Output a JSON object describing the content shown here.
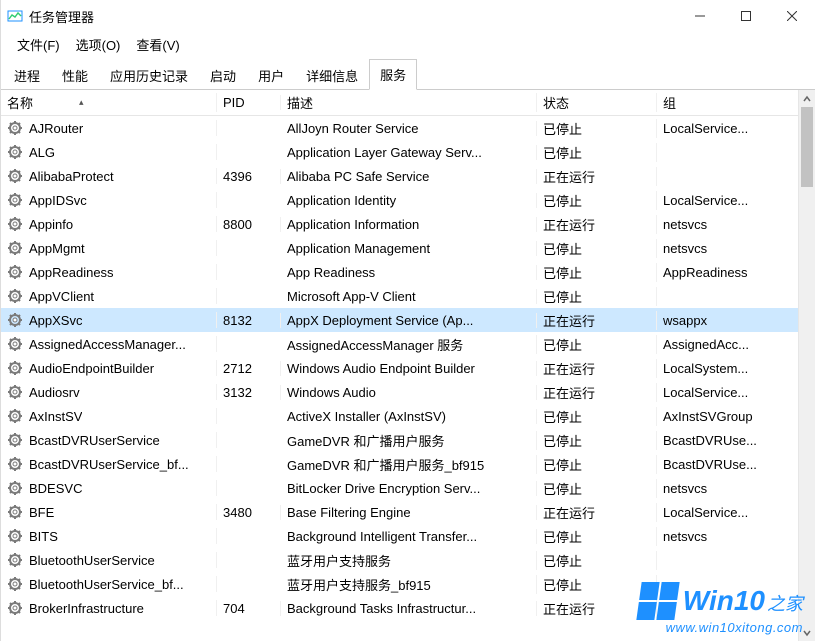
{
  "window": {
    "title": "任务管理器"
  },
  "menu": {
    "file": "文件(F)",
    "options": "选项(O)",
    "view": "查看(V)"
  },
  "tabs": {
    "processes": "进程",
    "performance": "性能",
    "app_history": "应用历史记录",
    "startup": "启动",
    "users": "用户",
    "details": "详细信息",
    "services": "服务"
  },
  "columns": {
    "name": "名称",
    "pid": "PID",
    "desc": "描述",
    "state": "状态",
    "group": "组"
  },
  "states": {
    "stopped": "已停止",
    "running": "正在运行"
  },
  "selected_index": 8,
  "services": [
    {
      "name": "AJRouter",
      "pid": "",
      "desc": "AllJoyn Router Service",
      "state": "已停止",
      "group": "LocalService..."
    },
    {
      "name": "ALG",
      "pid": "",
      "desc": "Application Layer Gateway Serv...",
      "state": "已停止",
      "group": ""
    },
    {
      "name": "AlibabaProtect",
      "pid": "4396",
      "desc": "Alibaba PC Safe Service",
      "state": "正在运行",
      "group": ""
    },
    {
      "name": "AppIDSvc",
      "pid": "",
      "desc": "Application Identity",
      "state": "已停止",
      "group": "LocalService..."
    },
    {
      "name": "Appinfo",
      "pid": "8800",
      "desc": "Application Information",
      "state": "正在运行",
      "group": "netsvcs"
    },
    {
      "name": "AppMgmt",
      "pid": "",
      "desc": "Application Management",
      "state": "已停止",
      "group": "netsvcs"
    },
    {
      "name": "AppReadiness",
      "pid": "",
      "desc": "App Readiness",
      "state": "已停止",
      "group": "AppReadiness"
    },
    {
      "name": "AppVClient",
      "pid": "",
      "desc": "Microsoft App-V Client",
      "state": "已停止",
      "group": ""
    },
    {
      "name": "AppXSvc",
      "pid": "8132",
      "desc": "AppX Deployment Service (Ap...",
      "state": "正在运行",
      "group": "wsappx"
    },
    {
      "name": "AssignedAccessManager...",
      "pid": "",
      "desc": "AssignedAccessManager 服务",
      "state": "已停止",
      "group": "AssignedAcc..."
    },
    {
      "name": "AudioEndpointBuilder",
      "pid": "2712",
      "desc": "Windows Audio Endpoint Builder",
      "state": "正在运行",
      "group": "LocalSystem..."
    },
    {
      "name": "Audiosrv",
      "pid": "3132",
      "desc": "Windows Audio",
      "state": "正在运行",
      "group": "LocalService..."
    },
    {
      "name": "AxInstSV",
      "pid": "",
      "desc": "ActiveX Installer (AxInstSV)",
      "state": "已停止",
      "group": "AxInstSVGroup"
    },
    {
      "name": "BcastDVRUserService",
      "pid": "",
      "desc": "GameDVR 和广播用户服务",
      "state": "已停止",
      "group": "BcastDVRUse..."
    },
    {
      "name": "BcastDVRUserService_bf...",
      "pid": "",
      "desc": "GameDVR 和广播用户服务_bf915",
      "state": "已停止",
      "group": "BcastDVRUse..."
    },
    {
      "name": "BDESVC",
      "pid": "",
      "desc": "BitLocker Drive Encryption Serv...",
      "state": "已停止",
      "group": "netsvcs"
    },
    {
      "name": "BFE",
      "pid": "3480",
      "desc": "Base Filtering Engine",
      "state": "正在运行",
      "group": "LocalService..."
    },
    {
      "name": "BITS",
      "pid": "",
      "desc": "Background Intelligent Transfer...",
      "state": "已停止",
      "group": "netsvcs"
    },
    {
      "name": "BluetoothUserService",
      "pid": "",
      "desc": "蓝牙用户支持服务",
      "state": "已停止",
      "group": ""
    },
    {
      "name": "BluetoothUserService_bf...",
      "pid": "",
      "desc": "蓝牙用户支持服务_bf915",
      "state": "已停止",
      "group": ""
    },
    {
      "name": "BrokerInfrastructure",
      "pid": "704",
      "desc": "Background Tasks Infrastructur...",
      "state": "正在运行",
      "group": ""
    }
  ],
  "watermark": {
    "brand_main": "Win10",
    "brand_sub": "之家",
    "url": "www.win10xitong.com"
  }
}
